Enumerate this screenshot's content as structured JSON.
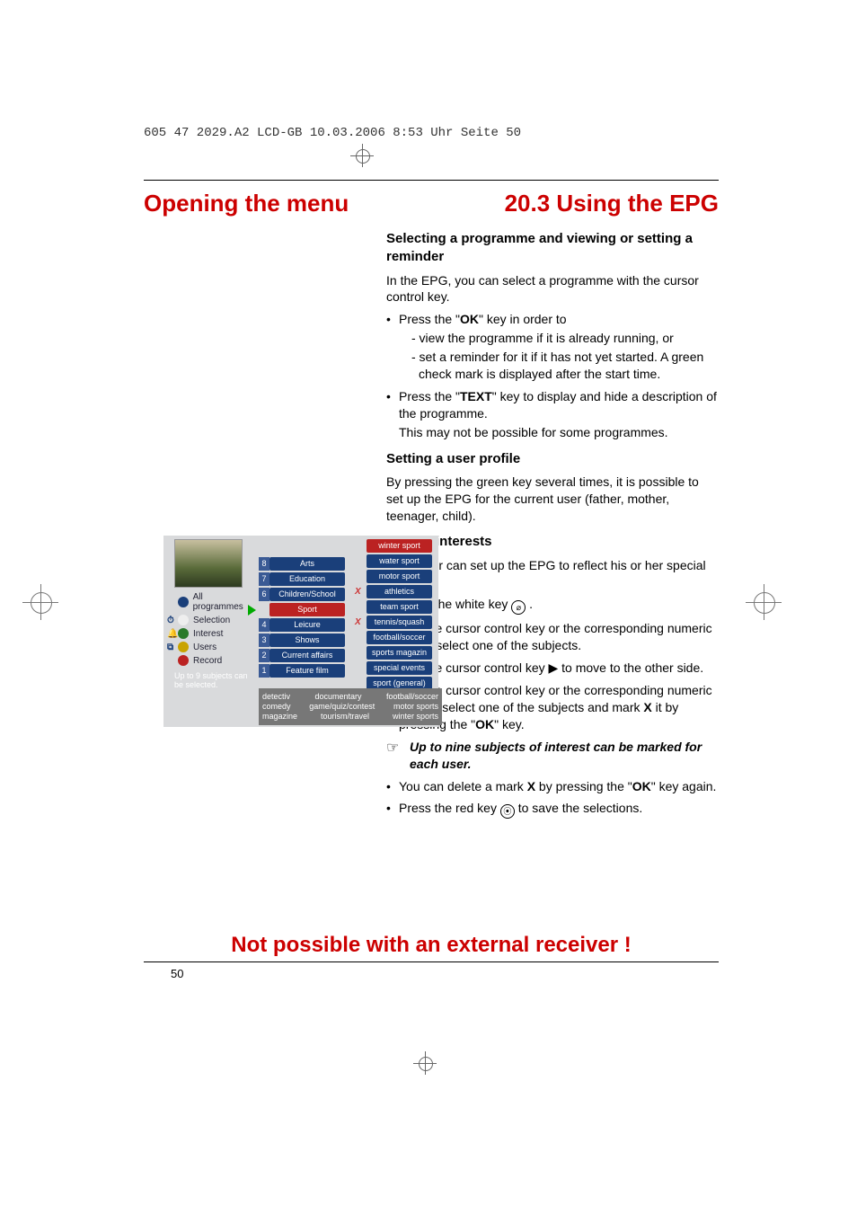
{
  "meta": {
    "header_note": "605 47 2029.A2 LCD-GB  10.03.2006  8:53 Uhr  Seite 50",
    "page_number": "50"
  },
  "titles": {
    "opening": "Opening the menu",
    "section": "20.3 Using the EPG",
    "bottom_banner": "Not possible with an external receiver !"
  },
  "content": {
    "h3": "Selecting a programme and viewing or setting a reminder",
    "p1": "In the EPG, you can select a programme with the cursor control key.",
    "b1_lead": "Press the \"",
    "b1_key": "OK",
    "b1_tail": "\" key in order to",
    "b1_sub1": "- view the programme if it is already running, or",
    "b1_sub2": "- set a reminder for it if it has not yet started. A green check mark is displayed after the start time.",
    "b2_lead": "Press the \"",
    "b2_key": "TEXT",
    "b2_rest": "\" key to display and hide a description of the programme.",
    "b2_line2": "This may not be possible for some programmes.",
    "h4a": "Setting a user profile",
    "p2": "By pressing the green key several times, it is possible to set up the EPG for the current user (father, mother, teenager, child).",
    "h4b": "Setting interests",
    "p3": "Each user can set up the EPG to reflect his or her special interests.",
    "b3": "Press the white key ",
    "b4": "Use the cursor control key or the corresponding numeric key to select one of the subjects.",
    "b5": "Use the cursor control key ▶ to move to the other side.",
    "b6_a": "Use the cursor control key or the corresponding numeric keys to select one of the subjects and mark ",
    "b6_x": "X",
    "b6_b": " it by pressing the \"",
    "b6_key": "OK",
    "b6_c": "\" key.",
    "note": "Up to nine subjects of interest can be marked for each user.",
    "b7_a": "You can delete a mark ",
    "b7_x": "X",
    "b7_b": " by pressing the \"",
    "b7_key": "OK",
    "b7_c": "\" key again.",
    "b8": "Press the red key ",
    "b8_b": " to save the selections."
  },
  "epg": {
    "hint": "Up to 9 subjects can be selected.",
    "side": {
      "all": "All programmes",
      "selection": "Selection",
      "interest": "Interest",
      "users": "Users",
      "record": "Record"
    },
    "mid": [
      {
        "n": "8",
        "label": "Arts"
      },
      {
        "n": "7",
        "label": "Education"
      },
      {
        "n": "6",
        "label": "Children/School"
      },
      {
        "n": "",
        "label": "Sport",
        "red": true
      },
      {
        "n": "4",
        "label": "Leicure"
      },
      {
        "n": "3",
        "label": "Shows"
      },
      {
        "n": "2",
        "label": "Current affairs"
      },
      {
        "n": "1",
        "label": "Feature film"
      }
    ],
    "right": [
      {
        "label": "winter sport",
        "x": false,
        "red": true
      },
      {
        "label": "water sport",
        "x": false
      },
      {
        "label": "motor sport",
        "x": false
      },
      {
        "label": "athletics",
        "x": true
      },
      {
        "label": "team sport",
        "x": false
      },
      {
        "label": "tennis/squash",
        "x": true
      },
      {
        "label": "football/soccer",
        "x": false
      },
      {
        "label": "sports magazin",
        "x": false
      },
      {
        "label": "special events",
        "x": false
      },
      {
        "label": "sport (general)",
        "x": false
      }
    ],
    "footer": [
      [
        "detectiv",
        "documentary",
        "football/soccer"
      ],
      [
        "comedy",
        "game/quiz/contest",
        "motor sports"
      ],
      [
        "magazine",
        "tourism/travel",
        "winter sports"
      ]
    ]
  }
}
